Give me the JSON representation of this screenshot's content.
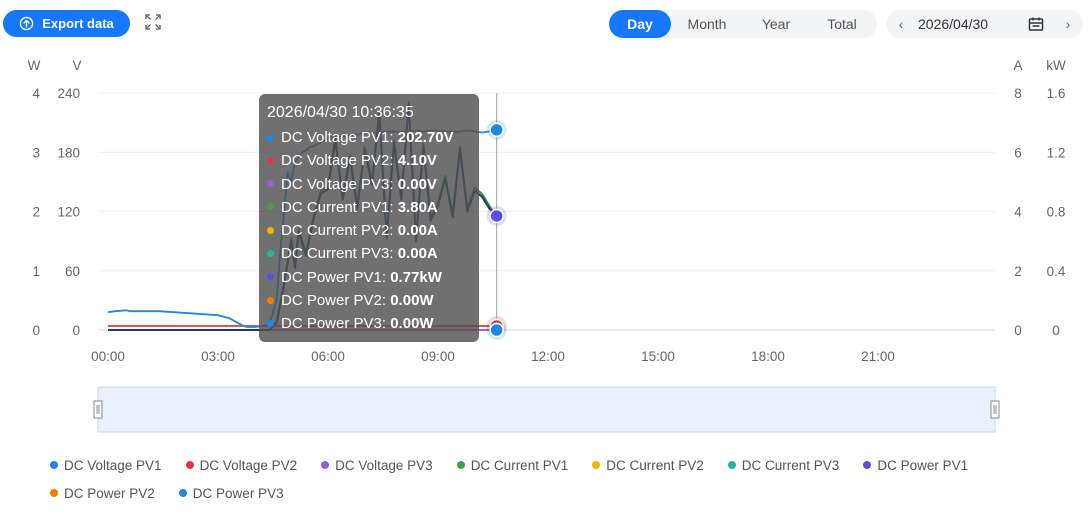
{
  "toolbar": {
    "export_label": "Export data",
    "tabs": [
      {
        "label": "Day",
        "active": true
      },
      {
        "label": "Month",
        "active": false
      },
      {
        "label": "Year",
        "active": false
      },
      {
        "label": "Total",
        "active": false
      }
    ],
    "date": "2026/04/30",
    "prev_icon": "chevron-left-icon",
    "next_icon": "chevron-right-icon",
    "calendar_icon": "calendar-icon",
    "fullscreen_icon": "fullscreen-icon",
    "export_icon": "upload-icon"
  },
  "chart_data": {
    "type": "line",
    "axes": {
      "left_outer": {
        "unit": "W",
        "ticks": [
          "0",
          "1",
          "2",
          "3",
          "4"
        ],
        "range": [
          0,
          4
        ]
      },
      "left_inner": {
        "unit": "V",
        "ticks": [
          "0",
          "60",
          "120",
          "180",
          "240"
        ],
        "range": [
          0,
          240
        ]
      },
      "right_inner": {
        "unit": "A",
        "ticks": [
          "0",
          "2",
          "4",
          "6",
          "8"
        ],
        "range": [
          0,
          8
        ]
      },
      "right_outer": {
        "unit": "kW",
        "ticks": [
          "0",
          "0.4",
          "0.8",
          "1.2",
          "1.6"
        ],
        "range": [
          0,
          1.6
        ]
      },
      "x": {
        "ticks": [
          "00:00",
          "03:00",
          "06:00",
          "09:00",
          "12:00",
          "15:00",
          "18:00",
          "21:00"
        ],
        "range_hours": [
          0,
          24
        ]
      }
    },
    "grid": true,
    "series": [
      {
        "name": "DC Voltage PV1",
        "color": "#1e88e5",
        "axis": "V",
        "t": [
          0,
          0.2,
          0.5,
          0.6,
          1.0,
          1.4,
          1.8,
          2.2,
          2.6,
          3.0,
          3.3,
          3.5,
          3.7,
          3.8,
          4.0,
          4.2,
          4.4,
          4.6,
          4.7,
          4.8,
          4.9,
          5.0,
          5.1,
          5.2,
          5.3,
          5.4,
          5.5,
          5.6,
          5.7,
          5.8,
          5.9,
          6.0,
          6.2,
          6.4,
          6.6,
          6.8,
          7.0,
          7.2,
          7.4,
          7.6,
          7.8,
          8.0,
          8.2,
          8.4,
          8.6,
          8.8,
          9.0,
          9.2,
          9.4,
          9.6,
          9.8,
          10.0,
          10.2,
          10.4,
          10.6
        ],
        "v": [
          18,
          19,
          20,
          19,
          19,
          19,
          18,
          17,
          16,
          15,
          12,
          8,
          4,
          3,
          3,
          4,
          6,
          30,
          80,
          120,
          160,
          150,
          170,
          175,
          180,
          182,
          185,
          186,
          188,
          190,
          192,
          194,
          195,
          196,
          197,
          198,
          199,
          200,
          200,
          201,
          201,
          200,
          201,
          202,
          201,
          202,
          202,
          201,
          200,
          201,
          202,
          201,
          200,
          201,
          202.7
        ]
      },
      {
        "name": "DC Voltage PV2",
        "color": "#e53935",
        "axis": "V",
        "t": [
          0,
          10.6
        ],
        "v": [
          4.1,
          4.1
        ]
      },
      {
        "name": "DC Voltage PV3",
        "color": "#9c5bd8",
        "axis": "V",
        "t": [
          0,
          10.6
        ],
        "v": [
          0,
          0
        ]
      },
      {
        "name": "DC Current PV1",
        "color": "#43a047",
        "axis": "A",
        "t": [
          0,
          4.4,
          4.6,
          4.8,
          5.0,
          5.1,
          5.2,
          5.4,
          5.6,
          5.8,
          6.0,
          6.2,
          6.4,
          6.6,
          6.8,
          7.0,
          7.2,
          7.4,
          7.6,
          7.8,
          8.0,
          8.2,
          8.4,
          8.6,
          8.8,
          9.0,
          9.2,
          9.4,
          9.6,
          9.8,
          10.0,
          10.2,
          10.4,
          10.6
        ],
        "v": [
          0,
          0,
          0.3,
          1.6,
          3.1,
          2.2,
          3.4,
          2.6,
          3.8,
          4.7,
          4.8,
          6.5,
          4.5,
          5.9,
          4.2,
          6.2,
          5.0,
          7.4,
          3.2,
          6.4,
          4.5,
          7.7,
          3.1,
          6.3,
          3.8,
          4.3,
          5.2,
          3.9,
          6.2,
          4.1,
          4.8,
          4.6,
          4.2,
          3.8
        ]
      },
      {
        "name": "DC Current PV2",
        "color": "#f4b400",
        "axis": "A",
        "t": [
          0,
          10.6
        ],
        "v": [
          0,
          0
        ]
      },
      {
        "name": "DC Current PV3",
        "color": "#26b3b0",
        "axis": "A",
        "t": [
          0,
          10.6
        ],
        "v": [
          0,
          0
        ]
      },
      {
        "name": "DC Power PV1",
        "color": "#5b4fe8",
        "axis": "kW",
        "t": [
          0,
          4.4,
          4.6,
          4.8,
          5.0,
          5.1,
          5.2,
          5.4,
          5.6,
          5.8,
          6.0,
          6.2,
          6.4,
          6.6,
          6.8,
          7.0,
          7.2,
          7.4,
          7.6,
          7.8,
          8.0,
          8.2,
          8.4,
          8.6,
          8.8,
          9.0,
          9.2,
          9.4,
          9.6,
          9.8,
          10.0,
          10.2,
          10.4,
          10.6
        ],
        "v": [
          0,
          0,
          0.05,
          0.3,
          0.6,
          0.42,
          0.66,
          0.5,
          0.74,
          0.92,
          0.95,
          1.28,
          0.88,
          1.16,
          0.82,
          1.22,
          0.98,
          1.46,
          0.62,
          1.26,
          0.88,
          1.52,
          0.6,
          1.24,
          0.74,
          0.84,
          1.02,
          0.76,
          1.22,
          0.8,
          0.94,
          0.9,
          0.82,
          0.77
        ]
      },
      {
        "name": "DC Power PV2",
        "color": "#f57c00",
        "axis": "W",
        "t": [
          0,
          10.6
        ],
        "v": [
          0,
          0
        ]
      },
      {
        "name": "DC Power PV3",
        "color": "#1e88e5",
        "axis": "W",
        "t": [
          0,
          10.6
        ],
        "v": [
          0,
          0
        ]
      }
    ],
    "cursor_hour": 10.6,
    "tooltip": {
      "title": "2026/04/30 10:36:35",
      "rows": [
        {
          "name": "DC Voltage PV1",
          "value": "202.70V"
        },
        {
          "name": "DC Voltage PV2",
          "value": "4.10V"
        },
        {
          "name": "DC Voltage PV3",
          "value": "0.00V"
        },
        {
          "name": "DC Current PV1",
          "value": "3.80A"
        },
        {
          "name": "DC Current PV2",
          "value": "0.00A"
        },
        {
          "name": "DC Current PV3",
          "value": "0.00A"
        },
        {
          "name": "DC Power PV1",
          "value": "0.77kW"
        },
        {
          "name": "DC Power PV2",
          "value": "0.00W"
        },
        {
          "name": "DC Power PV3",
          "value": "0.00W"
        }
      ]
    },
    "legend_placement": "bottom"
  }
}
